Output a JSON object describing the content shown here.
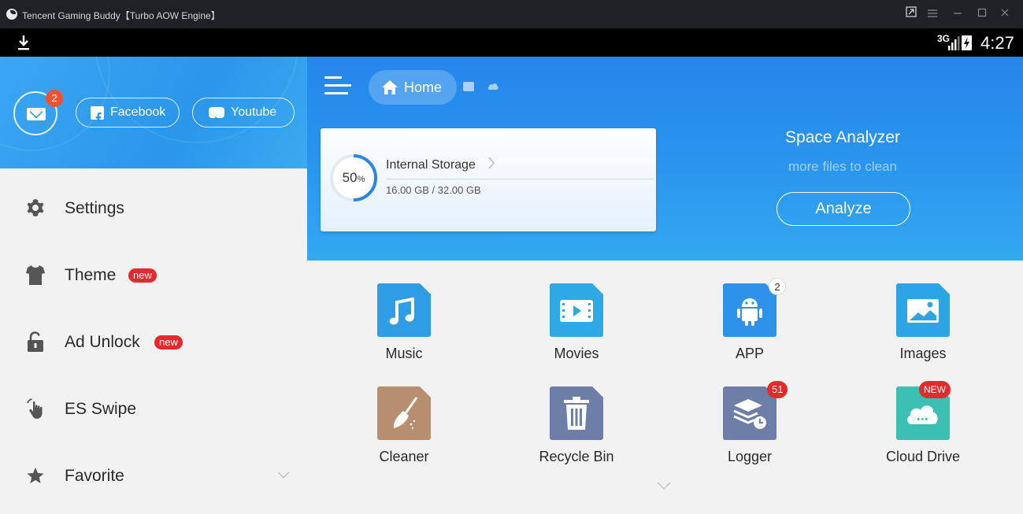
{
  "window": {
    "title": "Tencent Gaming Buddy【Turbo AOW Engine】"
  },
  "status_bar": {
    "network": "3G",
    "time": "4:27"
  },
  "drawer": {
    "mail_badge": "2",
    "facebook_label": "Facebook",
    "youtube_label": "Youtube",
    "items": [
      {
        "label": "Settings",
        "icon": "gear-icon",
        "badge": ""
      },
      {
        "label": "Theme",
        "icon": "shirt-icon",
        "badge": "new"
      },
      {
        "label": "Ad Unlock",
        "icon": "unlock-icon",
        "badge": "new"
      },
      {
        "label": "ES Swipe",
        "icon": "swipe-hand-icon",
        "badge": ""
      },
      {
        "label": "Favorite",
        "icon": "star-icon",
        "badge": ""
      }
    ]
  },
  "header": {
    "home_label": "Home"
  },
  "storage": {
    "percent": "50",
    "percent_unit": "%",
    "name": "Internal Storage",
    "size": "16.00 GB / 32.00 GB",
    "used_fraction": 0.5
  },
  "space_analyzer": {
    "title": "Space Analyzer",
    "subtitle": "more files to clean",
    "button": "Analyze"
  },
  "tiles": [
    {
      "label": "Music",
      "icon": "music-note-icon",
      "color": "#2f9ce6",
      "badge": ""
    },
    {
      "label": "Movies",
      "icon": "play-film-icon",
      "color": "#2fa8e6",
      "badge": ""
    },
    {
      "label": "APP",
      "icon": "android-icon",
      "color": "#2e93e8",
      "badge": "2"
    },
    {
      "label": "Images",
      "icon": "image-icon",
      "color": "#2da5e4",
      "badge": ""
    },
    {
      "label": "Cleaner",
      "icon": "broom-icon",
      "color": "#b78e70",
      "badge": ""
    },
    {
      "label": "Recycle Bin",
      "icon": "trash-icon",
      "color": "#6d7fa8",
      "badge": ""
    },
    {
      "label": "Logger",
      "icon": "logger-stack-icon",
      "color": "#6d7fa8",
      "badge": "51"
    },
    {
      "label": "Cloud Drive",
      "icon": "cloud-icon",
      "color": "#3cc0b3",
      "badge": "NEW"
    }
  ],
  "colors": {
    "accent": "#2a96ee",
    "badge_red": "#e8282b",
    "drawer_bg": "#f2f2f2"
  }
}
